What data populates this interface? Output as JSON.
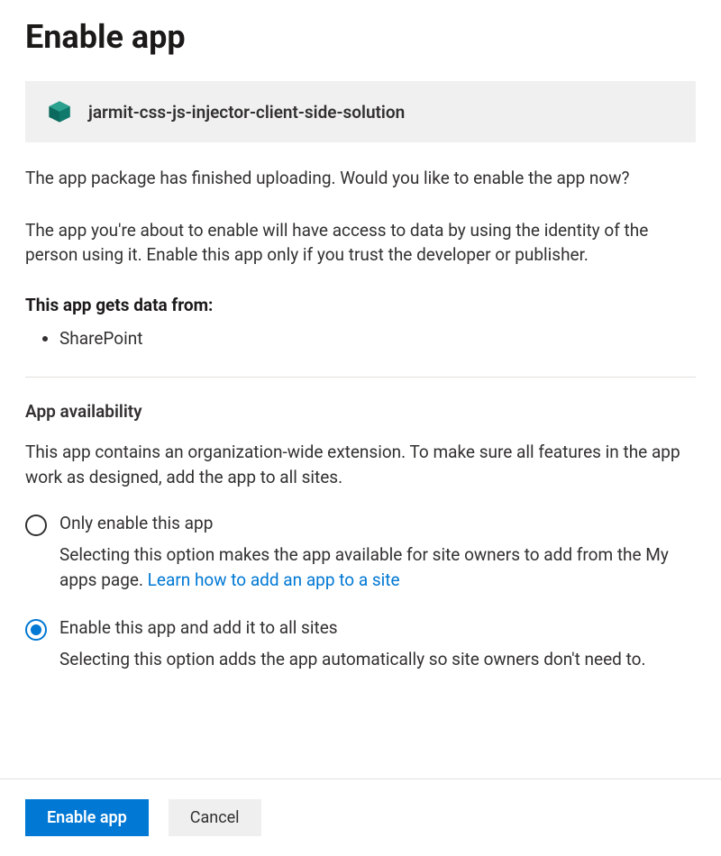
{
  "title": "Enable app",
  "app": {
    "icon": "package-icon",
    "name": "jarmit-css-js-injector-client-side-solution"
  },
  "intro_1": "The app package has finished uploading. Would you like to enable the app now?",
  "intro_2": "The app you're about to enable will have access to data by using the identity of the person using it. Enable this app only if you trust the developer or publisher.",
  "data_sources": {
    "heading": "This app gets data from:",
    "items": [
      "SharePoint"
    ]
  },
  "availability": {
    "heading": "App availability",
    "description": "This app contains an organization-wide extension. To make sure all features in the app work as designed, add the app to all sites.",
    "options": [
      {
        "label": "Only enable this app",
        "description": "Selecting this option makes the app available for site owners to add from the My apps page. ",
        "link_text": "Learn how to add an app to a site",
        "selected": false
      },
      {
        "label": "Enable this app and add it to all sites",
        "description": "Selecting this option adds the app automatically so site owners don't need to.",
        "link_text": "",
        "selected": true
      }
    ]
  },
  "actions": {
    "primary": "Enable app",
    "secondary": "Cancel"
  }
}
